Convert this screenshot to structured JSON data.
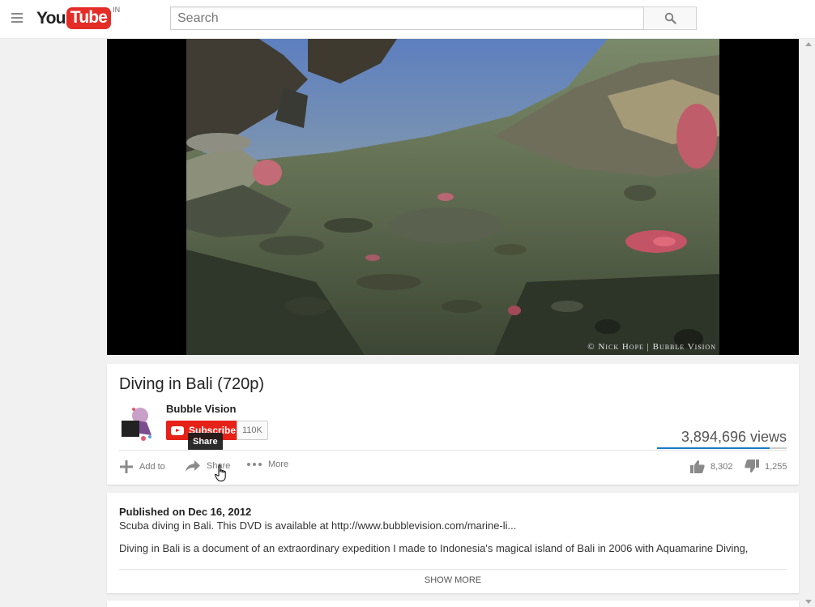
{
  "masthead": {
    "logo_you": "You",
    "logo_tube": "Tube",
    "logo_country": "IN",
    "search_placeholder": "Search"
  },
  "player": {
    "watermark": "© Nick Hope | Bubble Vision"
  },
  "video": {
    "title": "Diving in Bali (720p)",
    "channel": "Bubble Vision",
    "subscribe_label": "Subscribe",
    "subscriber_count": "110K",
    "views": "3,894,696 views",
    "like_ratio": 0.87,
    "tooltip": "Share",
    "actions": {
      "add_to": "Add to",
      "share": "Share",
      "more": "More"
    },
    "likes": "8,302",
    "dislikes": "1,255"
  },
  "description": {
    "published": "Published on Dec 16, 2012",
    "line1": "Scuba diving in Bali. This DVD is available at http://www.bubblevision.com/marine-li...",
    "line2": "Diving in Bali is a document of an extraordinary expedition I made to Indonesia's magical island of Bali in 2006 with Aquamarine Diving,",
    "show_more": "SHOW MORE"
  },
  "colors": {
    "brand_red": "#e52d27",
    "like_bar": "#167ac6"
  },
  "icons": [
    "hamburger-icon",
    "search-icon",
    "add-icon",
    "share-icon",
    "more-icon",
    "thumbs-up-icon",
    "thumbs-down-icon"
  ]
}
